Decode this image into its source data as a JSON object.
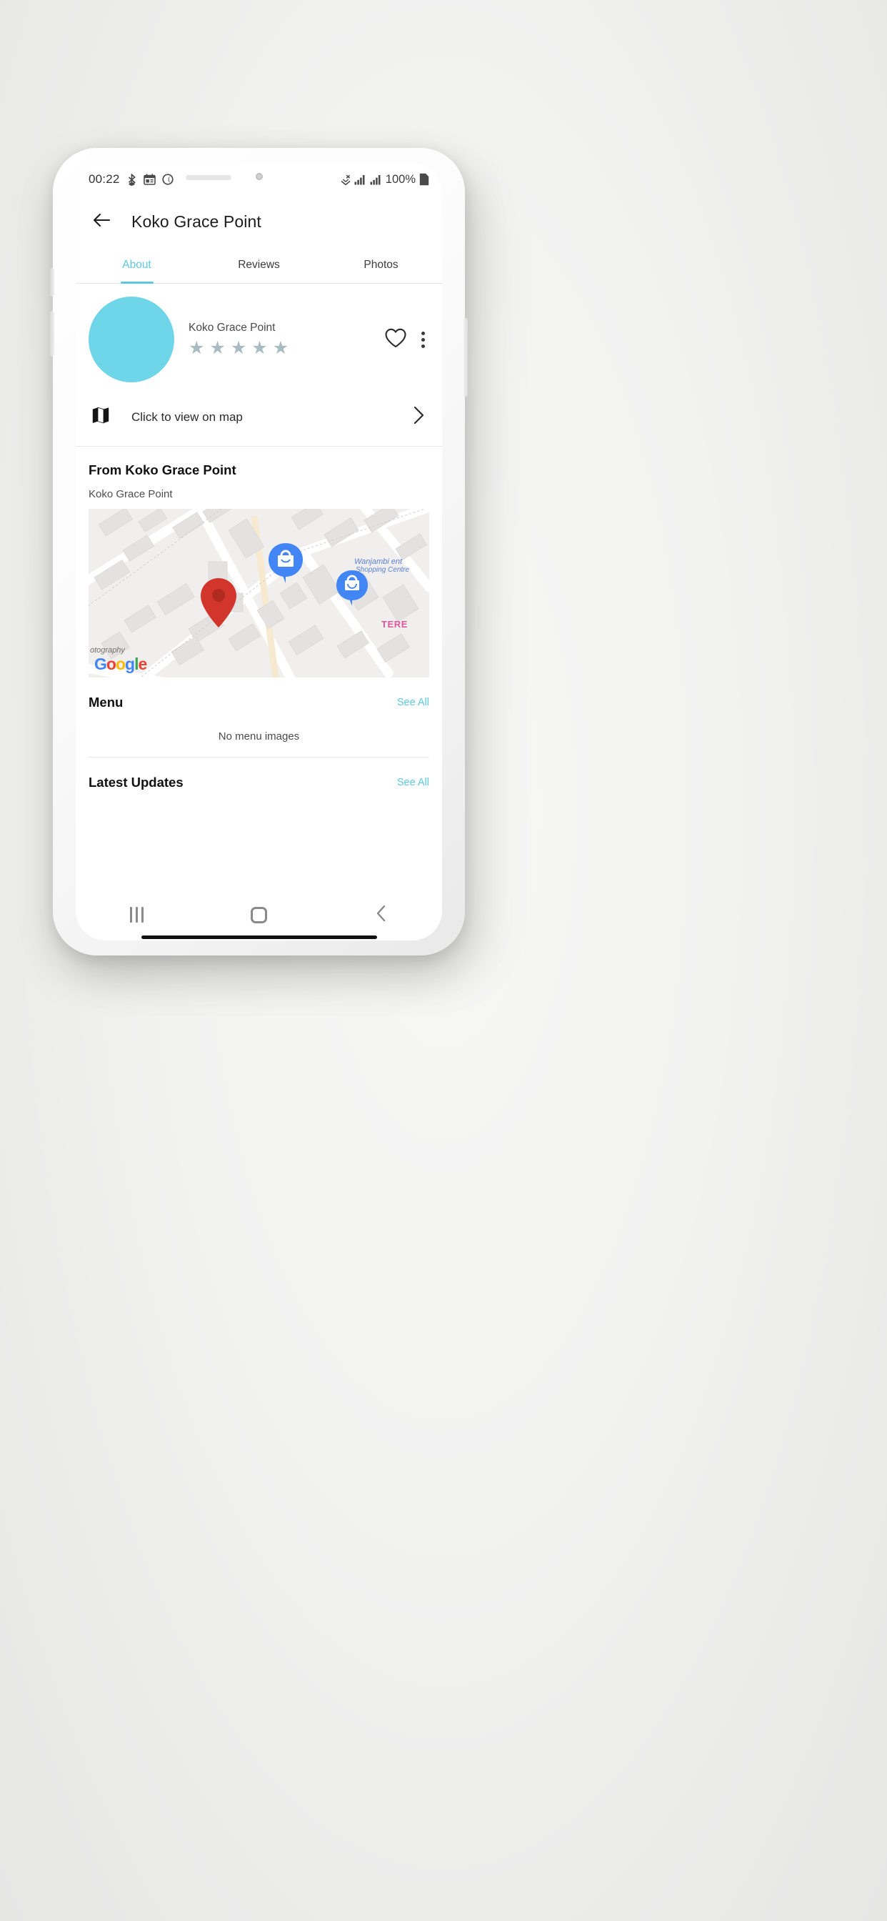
{
  "status_bar": {
    "clock": "00:22",
    "left_icons": [
      "bluetooth-tether-icon",
      "calendar-icon",
      "do-not-disturb-icon"
    ],
    "signal_icons": [
      "wifi-icon",
      "signal-bars-icon",
      "signal-bars-icon"
    ],
    "battery_percent": "100%",
    "battery_icon": "battery-full-icon"
  },
  "app_bar": {
    "back_icon": "back-arrow-icon",
    "title": "Koko Grace Point"
  },
  "tabs": [
    {
      "label": "About",
      "active": true
    },
    {
      "label": "Reviews",
      "active": false
    },
    {
      "label": "Photos",
      "active": false
    }
  ],
  "profile": {
    "avatar_color": "#6fd5e8",
    "name": "Koko Grace Point",
    "rating_stars_total": 5,
    "rating_stars_filled": 0,
    "star_color": "#a8bcc2",
    "favorite_icon": "heart-outline-icon",
    "overflow_icon": "more-vertical-icon"
  },
  "map_link": {
    "icon": "map-icon",
    "label": "Click to view on map",
    "chevron_icon": "chevron-right-icon"
  },
  "from_section": {
    "title": "From Koko Grace Point",
    "subtitle": "Koko Grace Point"
  },
  "map_preview": {
    "pin_icon": "location-pin-icon",
    "pin_color": "#d1352b",
    "markers": [
      {
        "icon": "shopping-bag-marker-icon",
        "color": "#4285F4"
      },
      {
        "icon": "shopping-bag-marker-icon",
        "color": "#4285F4"
      }
    ],
    "labels": {
      "shop_line1": "Wanjambi ent",
      "shop_line2": "Shopping Centre",
      "shop_color": "#5a7fd4",
      "street_tere": "TERE",
      "tere_color": "#e0559e",
      "photography": "otography"
    },
    "attribution": {
      "g1": "G",
      "o1": "o",
      "o2": "o",
      "g2": "g",
      "l": "l",
      "e": "e"
    }
  },
  "menu_section": {
    "title": "Menu",
    "see_all": "See All",
    "empty_text": "No menu images"
  },
  "latest_section": {
    "title": "Latest Updates",
    "see_all": "See All"
  },
  "nav_bar": {
    "recent_icon": "recent-apps-icon",
    "home_icon": "home-icon",
    "back_icon": "nav-back-icon"
  },
  "colors": {
    "accent": "#5ec8e0",
    "avatar": "#6fd5e8",
    "pin": "#d1352b"
  }
}
